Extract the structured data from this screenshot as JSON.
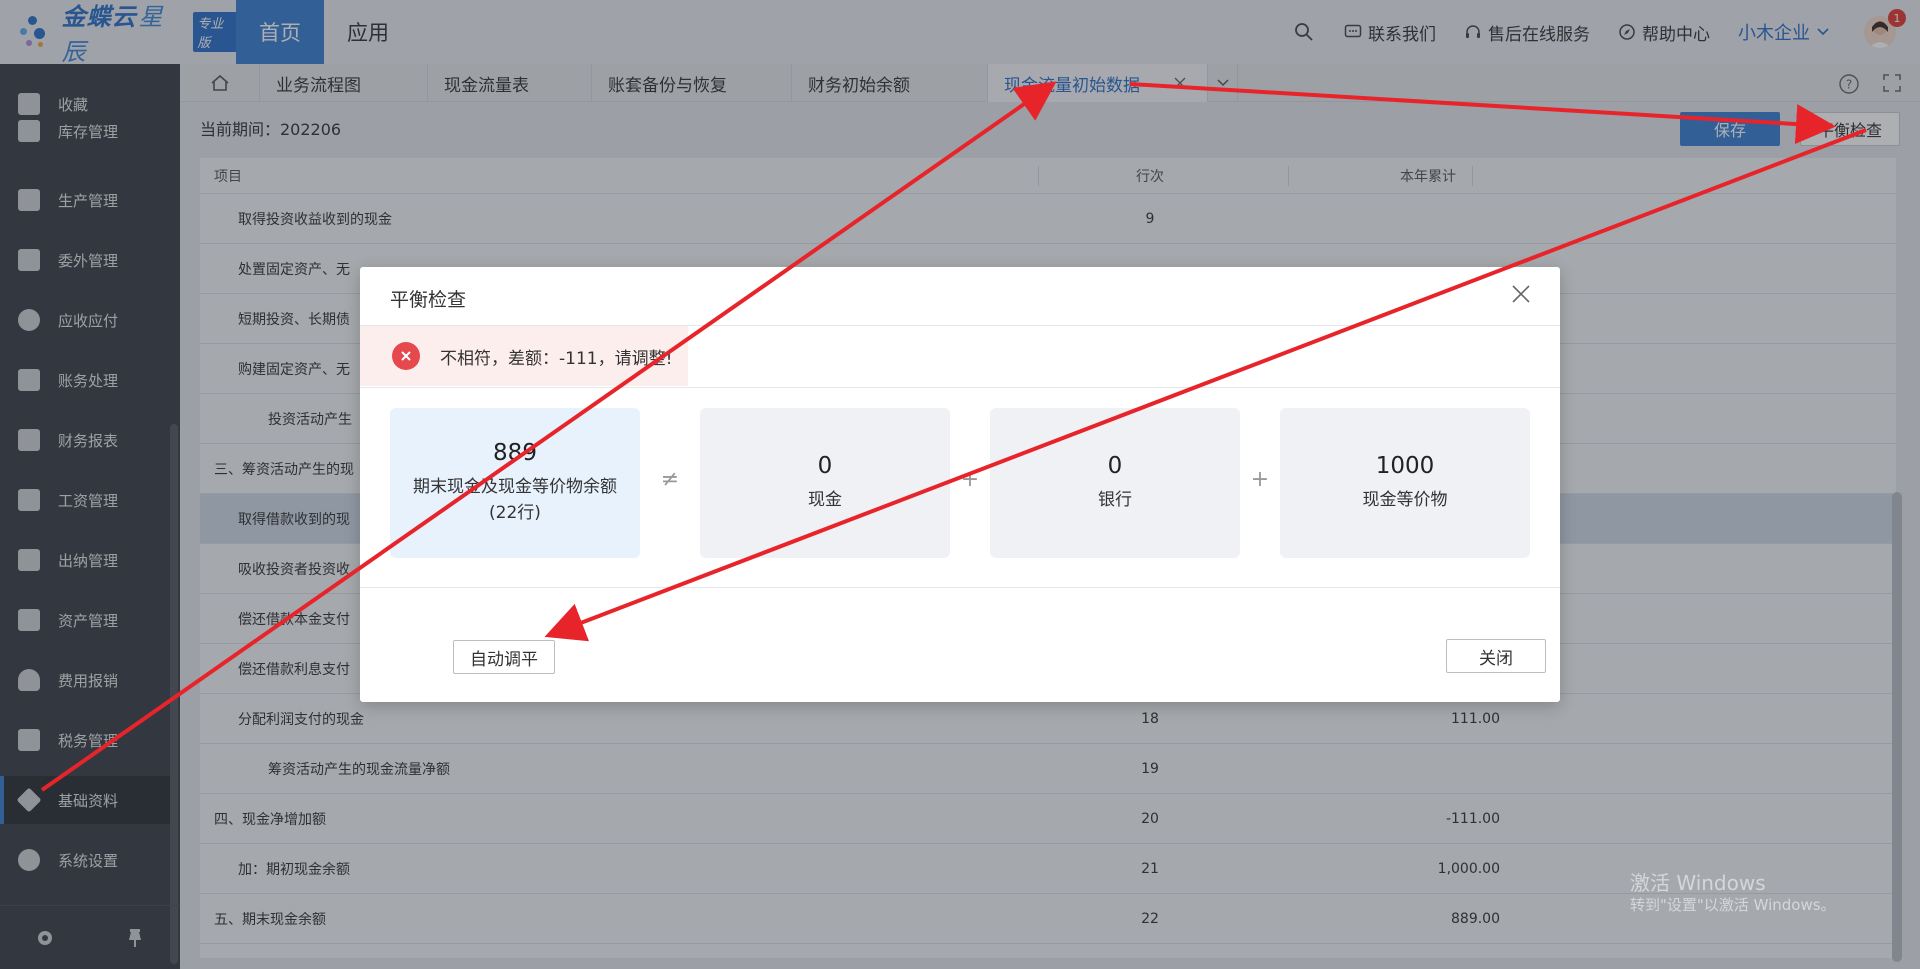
{
  "brand": {
    "name": "金蝶云",
    "sub": "星辰",
    "edition": "专业版"
  },
  "nav": {
    "home": "首页",
    "app": "应用"
  },
  "top": {
    "contact": "联系我们",
    "service": "售后在线服务",
    "help": "帮助中心",
    "company": "小木企业",
    "notifications": "1"
  },
  "sidebar": {
    "items": [
      {
        "label": "收藏",
        "icon": "star-icon"
      },
      {
        "label": "库存管理",
        "icon": "box-icon"
      },
      {
        "label": "生产管理",
        "icon": "tools-icon"
      },
      {
        "label": "委外管理",
        "icon": "document-icon"
      },
      {
        "label": "应收应付",
        "icon": "coin-icon"
      },
      {
        "label": "账务处理",
        "icon": "ledger-icon"
      },
      {
        "label": "财务报表",
        "icon": "chart-icon"
      },
      {
        "label": "工资管理",
        "icon": "salary-icon"
      },
      {
        "label": "出纳管理",
        "icon": "cashier-icon"
      },
      {
        "label": "资产管理",
        "icon": "asset-icon"
      },
      {
        "label": "费用报销",
        "icon": "expense-icon"
      },
      {
        "label": "税务管理",
        "icon": "tax-icon"
      },
      {
        "label": "基础资料",
        "icon": "layers-icon"
      },
      {
        "label": "系统设置",
        "icon": "gear-icon"
      }
    ]
  },
  "tabs": [
    {
      "label": "业务流程图"
    },
    {
      "label": "现金流量表"
    },
    {
      "label": "账套备份与恢复"
    },
    {
      "label": "财务初始余额"
    },
    {
      "label": "现金流量初始数据"
    }
  ],
  "page": {
    "period": "当前期间：202206",
    "save": "保存",
    "balance_check": "平衡检查"
  },
  "table": {
    "headers": {
      "item": "项目",
      "line": "行次",
      "ytd": "本年累计"
    },
    "rows": [
      {
        "name": "取得投资收益收到的现金",
        "line": "9",
        "amount": ""
      },
      {
        "name": "处置固定资产、无",
        "line": "",
        "amount": ""
      },
      {
        "name": "短期投资、长期债",
        "line": "",
        "amount": ""
      },
      {
        "name": "购建固定资产、无",
        "line": "",
        "amount": ""
      },
      {
        "name": "投资活动产生",
        "line": "",
        "amount": ""
      },
      {
        "name": "三、筹资活动产生的现",
        "line": "",
        "amount": ""
      },
      {
        "name": "取得借款收到的现",
        "line": "",
        "amount": ""
      },
      {
        "name": "吸收投资者投资收",
        "line": "",
        "amount": ""
      },
      {
        "name": "偿还借款本金支付",
        "line": "",
        "amount": ""
      },
      {
        "name": "偿还借款利息支付",
        "line": "",
        "amount": ""
      },
      {
        "name": "分配利润支付的现金",
        "line": "18",
        "amount": "111.00"
      },
      {
        "name": "筹资活动产生的现金流量净额",
        "line": "19",
        "amount": ""
      },
      {
        "name": "四、现金净增加额",
        "line": "20",
        "amount": "-111.00"
      },
      {
        "name": "加：期初现金余额",
        "line": "21",
        "amount": "1,000.00"
      },
      {
        "name": "五、期末现金余额",
        "line": "22",
        "amount": "889.00"
      }
    ]
  },
  "modal": {
    "title": "平衡检查",
    "alert": "不相符，差额：-111，请调整!",
    "boxes": [
      {
        "value": "889",
        "label": "期末现金及现金等价物余额",
        "sub": "(22行)"
      },
      {
        "value": "0",
        "label": "现金",
        "sub": ""
      },
      {
        "value": "0",
        "label": "银行",
        "sub": ""
      },
      {
        "value": "1000",
        "label": "现金等价物",
        "sub": ""
      }
    ],
    "ops": {
      "neq": "≠",
      "plus1": "+",
      "plus2": "+"
    },
    "auto_balance": "自动调平",
    "close": "关闭"
  },
  "watermark": {
    "line1": "激活 Windows",
    "line2": "转到\"设置\"以激活 Windows。"
  },
  "colors": {
    "brand": "#3b7fd4",
    "arrow": "#e8242b",
    "error": "#e5484d"
  }
}
